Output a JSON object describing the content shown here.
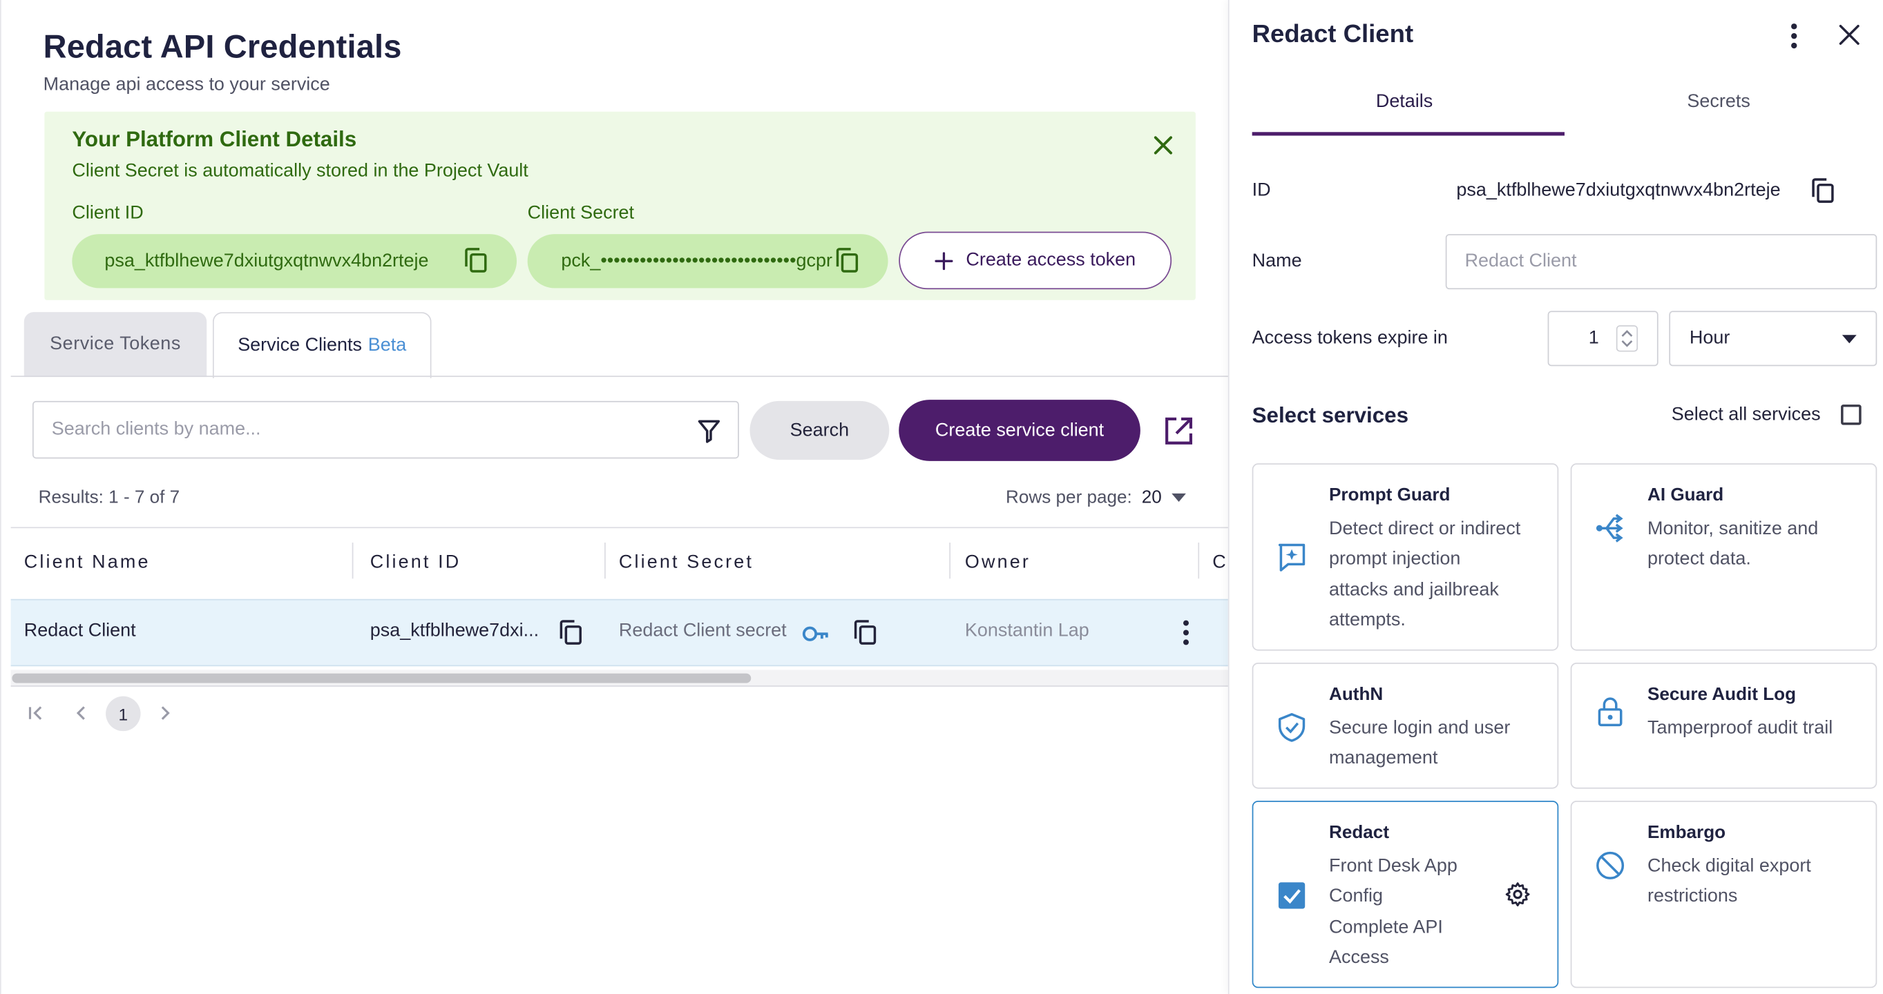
{
  "page": {
    "title": "Redact API Credentials",
    "subtitle": "Manage api access to your service"
  },
  "notice": {
    "title": "Your Platform Client Details",
    "subtitle": "Client Secret is automatically stored in the Project Vault",
    "client_id_label": "Client ID",
    "client_id_value": "psa_ktfblhewe7dxiutgxqtnwvx4bn2rteje",
    "client_secret_label": "Client Secret",
    "client_secret_value": "pck_••••••••••••••••••••••••••••••gcpr",
    "access_token_button": "Create access token"
  },
  "tabs": {
    "service_tokens": "Service Tokens",
    "service_clients": "Service Clients",
    "beta_tag": "Beta"
  },
  "toolbar": {
    "search_placeholder": "Search clients by name...",
    "search_button": "Search",
    "create_button": "Create service client"
  },
  "results": {
    "summary": "Results: 1 - 7 of 7",
    "rows_per_page_label": "Rows per page:",
    "rows_per_page_value": "20"
  },
  "table": {
    "headers": [
      "Client Name",
      "Client ID",
      "Client Secret",
      "Owner",
      "C"
    ],
    "rows": [
      {
        "name": "Redact Client",
        "client_id": "psa_ktfblhewe7dxi...",
        "client_secret": "Redact Client secret",
        "owner": "Konstantin Lap"
      }
    ]
  },
  "pagination": {
    "current_page": "1"
  },
  "panel": {
    "title": "Redact Client",
    "tabs": [
      "Details",
      "Secrets"
    ],
    "id_label": "ID",
    "id_value": "psa_ktfblhewe7dxiutgxqtnwvx4bn2rteje",
    "name_label": "Name",
    "name_placeholder": "Redact Client",
    "expire_label": "Access tokens expire in",
    "expire_value": "1",
    "expire_unit": "Hour",
    "services_title": "Select services",
    "select_all_label": "Select all services",
    "select_all_checked": false,
    "services": [
      {
        "name": "Prompt Guard",
        "desc_lines": [
          "Detect direct or indirect",
          "prompt injection",
          "attacks and jailbreak",
          "attempts."
        ],
        "icon": "prompt-guard-icon",
        "selected": false
      },
      {
        "name": "AI Guard",
        "desc_lines": [
          "Monitor, sanitize and",
          "protect data."
        ],
        "icon": "ai-guard-icon",
        "selected": false
      },
      {
        "name": "AuthN",
        "desc_lines": [
          "Secure login and user",
          "management"
        ],
        "icon": "shield-check-icon",
        "selected": false
      },
      {
        "name": "Secure Audit Log",
        "desc_lines": [
          "Tamperproof audit trail"
        ],
        "icon": "lock-icon",
        "selected": false
      },
      {
        "name": "Redact",
        "desc_lines": [
          "Front Desk App",
          "Config",
          "Complete API",
          "Access"
        ],
        "icon": "checkbox-checked-icon",
        "selected": true
      },
      {
        "name": "Embargo",
        "desc_lines": [
          "Check digital export",
          "restrictions"
        ],
        "icon": "block-icon",
        "selected": false
      }
    ]
  },
  "colors": {
    "brand_purple": "#4d1d6b",
    "notice_bg": "#eef9e6",
    "notice_text": "#2f6a10",
    "pill_bg": "#c9ecb1",
    "selected_row_bg": "#e7f3fb",
    "accent_blue": "#3a86c9"
  }
}
